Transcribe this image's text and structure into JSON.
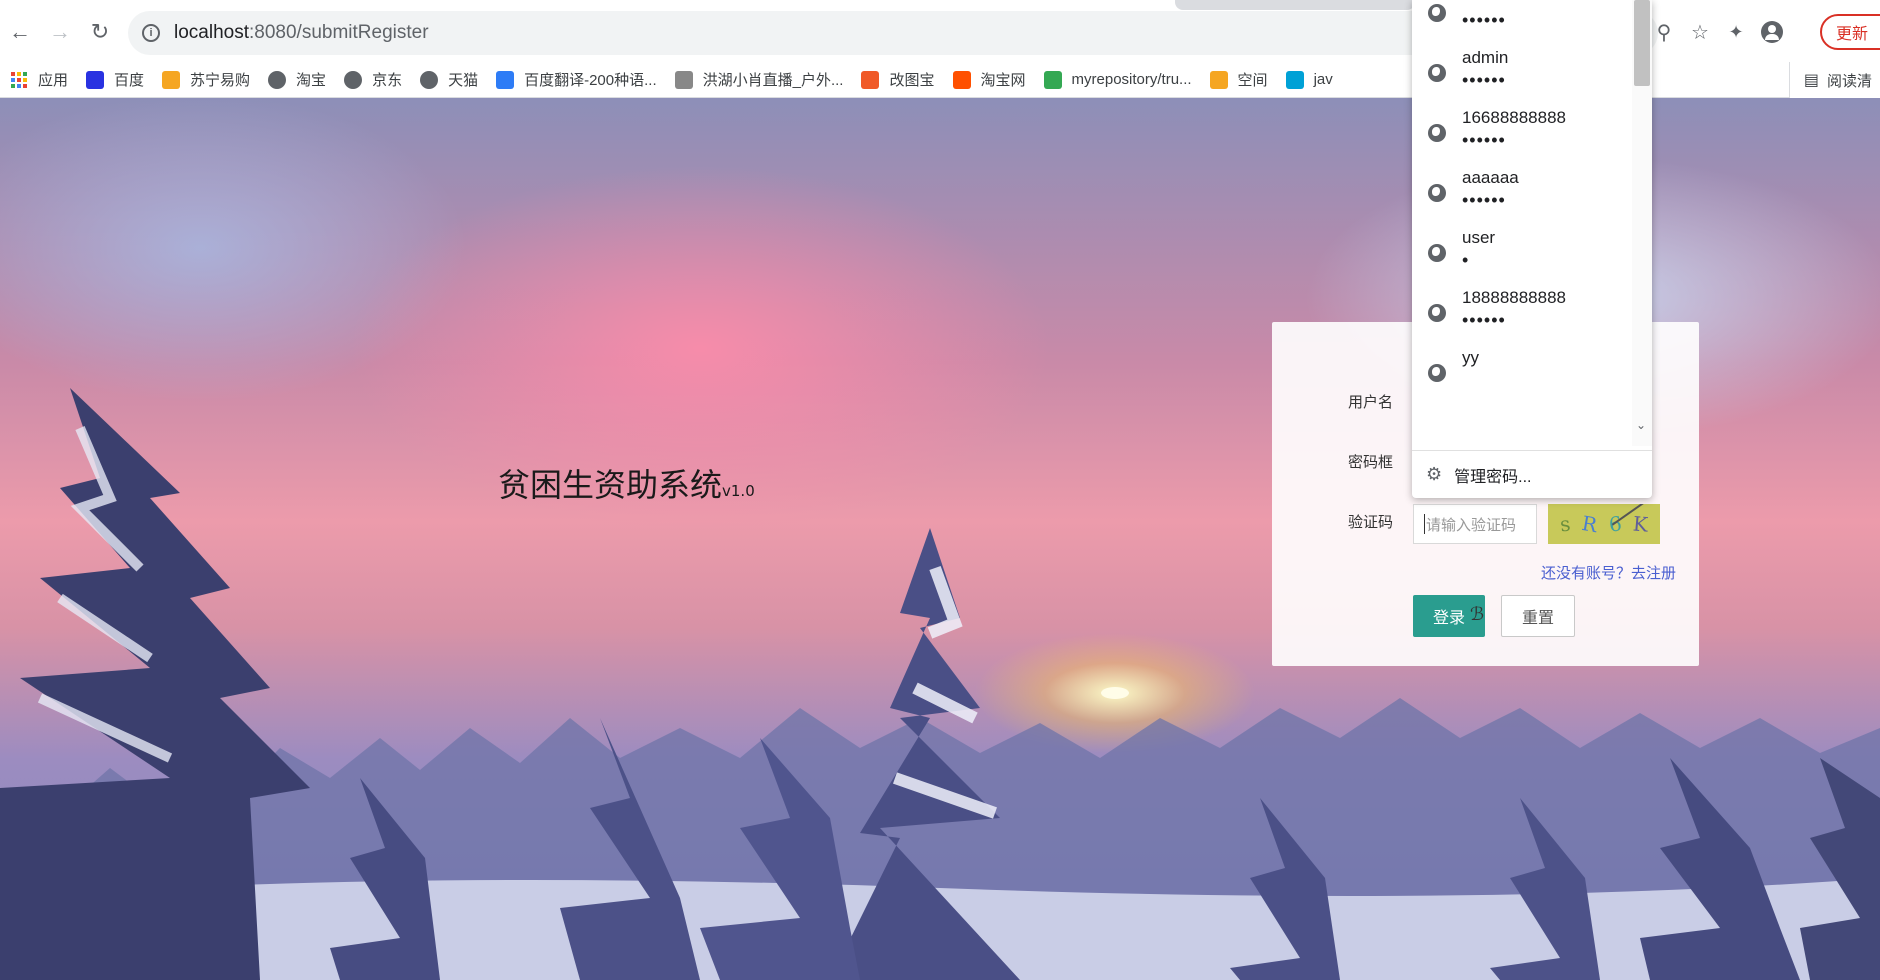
{
  "browser": {
    "url_host": "localhost",
    "url_rest": ":8080/submitRegister",
    "update_label": "更新",
    "reading_list_label": "阅读清"
  },
  "bookmarks": [
    {
      "label": "应用",
      "icon": "apps-grid-icon",
      "color": "#1a73e8"
    },
    {
      "label": "百度",
      "icon": "baidu-paw-icon",
      "color": "#2932e1"
    },
    {
      "label": "苏宁易购",
      "icon": "suning-icon",
      "color": "#f5a623"
    },
    {
      "label": "淘宝",
      "icon": "globe-icon",
      "color": "#5f6368"
    },
    {
      "label": "京东",
      "icon": "globe-icon",
      "color": "#5f6368"
    },
    {
      "label": "天猫",
      "icon": "globe-icon",
      "color": "#5f6368"
    },
    {
      "label": "百度翻译-200种语...",
      "icon": "translate-icon",
      "color": "#2e7cf6"
    },
    {
      "label": "洪湖小肖直播_户外...",
      "icon": "bird-icon",
      "color": "#888888"
    },
    {
      "label": "改图宝",
      "icon": "gaitubao-icon",
      "color": "#f05a28"
    },
    {
      "label": "淘宝网",
      "icon": "taobao-icon",
      "color": "#ff5000"
    },
    {
      "label": "myrepository/tru...",
      "icon": "chrome-icon",
      "color": "#34a853"
    },
    {
      "label": "空间",
      "icon": "qzone-icon",
      "color": "#f5a623"
    },
    {
      "label": "jav",
      "icon": "bilibili-icon",
      "color": "#00a1d6"
    }
  ],
  "page": {
    "system_title": "贫困生资助系统",
    "system_version": "v1.0",
    "username_label": "用户名",
    "password_label": "密码框",
    "captcha_label": "验证码",
    "captcha_placeholder": "请输入验证码",
    "captcha_chars": [
      "s",
      "R",
      "6",
      "K"
    ],
    "register_link": "还没有账号？去注册",
    "login_button": "登录",
    "reset_button": "重置"
  },
  "autofill": {
    "items": [
      {
        "username": "",
        "password": "••••••"
      },
      {
        "username": "admin",
        "password": "••••••"
      },
      {
        "username": "16688888888",
        "password": "••••••"
      },
      {
        "username": "aaaaaa",
        "password": "••••••"
      },
      {
        "username": "user",
        "password": "•"
      },
      {
        "username": "18888888888",
        "password": "••••••"
      },
      {
        "username": "yy",
        "password": ""
      }
    ],
    "manage_label": "管理密码..."
  },
  "colors": {
    "accent_login": "#2a9d8f",
    "link": "#4a5fd0",
    "update": "#d93025"
  }
}
